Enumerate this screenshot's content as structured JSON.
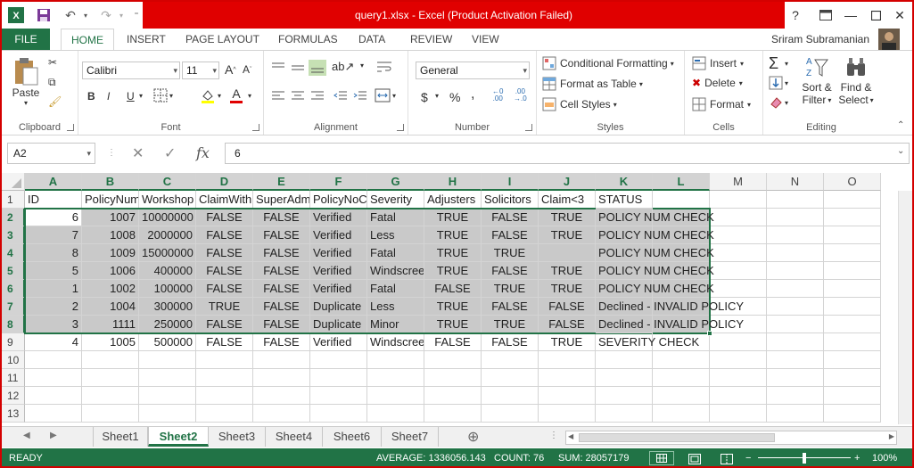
{
  "title_bar": {
    "title": "query1.xlsx -  Excel (Product Activation Failed)",
    "help_label": "?"
  },
  "ribbon_tabs": [
    "FILE",
    "HOME",
    "INSERT",
    "PAGE LAYOUT",
    "FORMULAS",
    "DATA",
    "REVIEW",
    "VIEW"
  ],
  "user_name": "Sriram Subramanian",
  "ribbon": {
    "clipboard": {
      "paste_label": "Paste",
      "group_label": "Clipboard"
    },
    "font": {
      "font_name": "Calibri",
      "font_size": "11",
      "bold": "B",
      "italic": "I",
      "underline": "U",
      "group_label": "Font"
    },
    "alignment": {
      "group_label": "Alignment"
    },
    "number": {
      "format": "General",
      "currency": "$",
      "percent": "%",
      "comma": ",",
      "group_label": "Number"
    },
    "styles": {
      "conditional_formatting": "Conditional Formatting",
      "format_as_table": "Format as Table",
      "cell_styles": "Cell Styles",
      "group_label": "Styles"
    },
    "cells": {
      "insert": "Insert",
      "delete": "Delete",
      "format": "Format",
      "group_label": "Cells"
    },
    "editing": {
      "sort_filter_1": "Sort &",
      "sort_filter_2": "Filter",
      "find_select_1": "Find &",
      "find_select_2": "Select",
      "group_label": "Editing"
    }
  },
  "formula_bar": {
    "name_box": "A2",
    "fx": "fx",
    "value": "6"
  },
  "grid": {
    "columns": [
      "A",
      "B",
      "C",
      "D",
      "E",
      "F",
      "G",
      "H",
      "I",
      "J",
      "K",
      "L",
      "M",
      "N",
      "O"
    ],
    "rows": [
      {
        "n": "1",
        "cells": [
          "ID",
          "PolicyNum",
          "Workshop",
          "ClaimWith",
          "SuperAdm",
          "PolicyNoC",
          "Severity",
          "Adjusters",
          "Solicitors",
          "Claim<3",
          "STATUS",
          ""
        ]
      },
      {
        "n": "2",
        "cells": [
          "6",
          "1007",
          "10000000",
          "FALSE",
          "FALSE",
          "Verified",
          "Fatal",
          "TRUE",
          "FALSE",
          "TRUE",
          "POLICY NUM CHECK",
          ""
        ]
      },
      {
        "n": "3",
        "cells": [
          "7",
          "1008",
          "2000000",
          "FALSE",
          "FALSE",
          "Verified",
          "Less",
          "TRUE",
          "FALSE",
          "TRUE",
          "POLICY NUM CHECK",
          ""
        ]
      },
      {
        "n": "4",
        "cells": [
          "8",
          "1009",
          "15000000",
          "FALSE",
          "FALSE",
          "Verified",
          "Fatal",
          "TRUE",
          "TRUE",
          "",
          "POLICY NUM CHECK",
          ""
        ]
      },
      {
        "n": "5",
        "cells": [
          "5",
          "1006",
          "400000",
          "FALSE",
          "FALSE",
          "Verified",
          "Windscreen",
          "TRUE",
          "FALSE",
          "TRUE",
          "POLICY NUM CHECK",
          ""
        ]
      },
      {
        "n": "6",
        "cells": [
          "1",
          "1002",
          "100000",
          "FALSE",
          "FALSE",
          "Verified",
          "Fatal",
          "FALSE",
          "TRUE",
          "TRUE",
          "POLICY NUM CHECK",
          ""
        ]
      },
      {
        "n": "7",
        "cells": [
          "2",
          "1004",
          "300000",
          "TRUE",
          "FALSE",
          "Duplicate",
          "Less",
          "TRUE",
          "FALSE",
          "FALSE",
          "Declined - INVALID POLICY",
          ""
        ]
      },
      {
        "n": "8",
        "cells": [
          "3",
          "1111",
          "250000",
          "FALSE",
          "FALSE",
          "Duplicate",
          "Minor",
          "TRUE",
          "TRUE",
          "FALSE",
          "Declined - INVALID POLICY",
          ""
        ]
      },
      {
        "n": "9",
        "cells": [
          "4",
          "1005",
          "500000",
          "FALSE",
          "FALSE",
          "Verified",
          "Windscreen",
          "FALSE",
          "FALSE",
          "TRUE",
          "SEVERITY CHECK",
          ""
        ]
      },
      {
        "n": "10",
        "cells": []
      },
      {
        "n": "11",
        "cells": []
      },
      {
        "n": "12",
        "cells": []
      },
      {
        "n": "13",
        "cells": []
      }
    ]
  },
  "sheet_tabs": [
    "Sheet1",
    "Sheet2",
    "Sheet3",
    "Sheet4",
    "Sheet6",
    "Sheet7"
  ],
  "active_sheet": "Sheet2",
  "status_bar": {
    "mode": "READY",
    "average": "AVERAGE: 1336056.143",
    "count": "COUNT: 76",
    "sum": "SUM: 28057179",
    "zoom": "100%"
  },
  "colors": {
    "excel_green": "#217346",
    "title_red": "#e00000",
    "selection_gray": "#c9c9c9"
  }
}
